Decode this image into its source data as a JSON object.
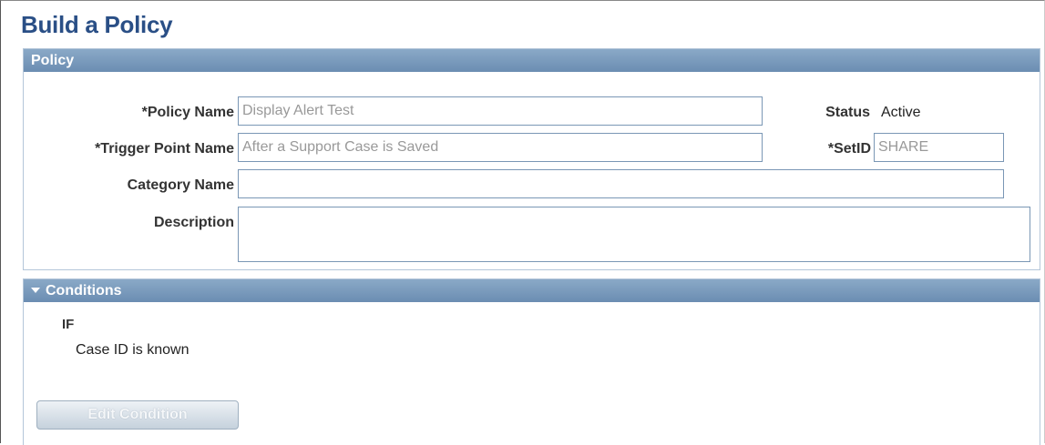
{
  "page": {
    "title": "Build a Policy"
  },
  "policy": {
    "header": "Policy",
    "policy_name_label": "*Policy Name",
    "policy_name_value": "Display Alert Test",
    "trigger_label": "*Trigger Point Name",
    "trigger_value": "After a Support Case is Saved",
    "category_label": "Category Name",
    "category_value": "",
    "description_label": "Description",
    "description_value": "",
    "status_label": "Status",
    "status_value": "Active",
    "setid_label": "*SetID",
    "setid_value": "SHARE"
  },
  "conditions": {
    "header": "Conditions",
    "if_label": "IF",
    "condition_text": "Case ID is known",
    "edit_button": "Edit Condition"
  },
  "colors": {
    "title": "#2a4f86",
    "header_bg": "#7393b8",
    "field_border": "#7a97b5"
  }
}
